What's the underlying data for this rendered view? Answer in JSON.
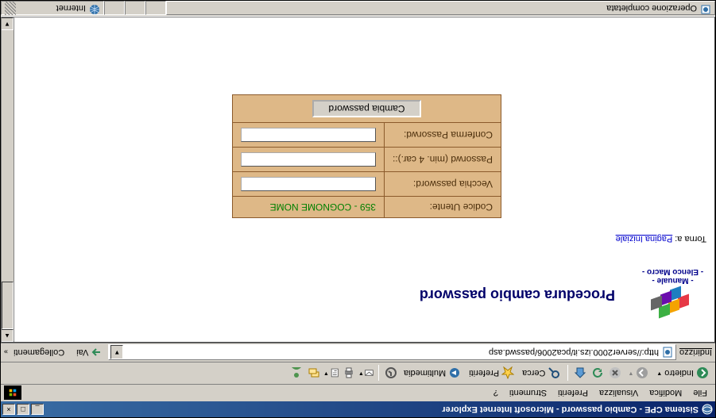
{
  "window": {
    "title": "Sistema CPE - Cambio password - Microsoft Internet Explorer"
  },
  "menu": [
    "File",
    "Modifica",
    "Visualizza",
    "Preferiti",
    "Strumenti",
    "?"
  ],
  "toolbar": {
    "back": "Indietro",
    "search": "Cerca",
    "favorites": "Preferiti",
    "media": "Multimedia"
  },
  "address": {
    "label": "Indirizzo",
    "url": "http://server2000.izs.it/pca2006/passwd.asp",
    "go": "Vai",
    "links": "Collegamenti"
  },
  "page": {
    "link_manual": "- Manuale -",
    "link_macro": "- Elenco Macro -",
    "title": "Procedura cambio password",
    "back_label": "Torna a:",
    "back_link": "Pagina Iniziale"
  },
  "form": {
    "row_user_label": "Codice Utente:",
    "row_user_value": "359 - COGNOME NOME",
    "row_old_label": "Vecchia password:",
    "row_new_label": "Passorwd (min. 4 car.)::",
    "row_confirm_label": "Conferma Passorwd:",
    "submit": "Cambia password"
  },
  "status": {
    "text": "Operazione completata",
    "zone": "Internet"
  }
}
